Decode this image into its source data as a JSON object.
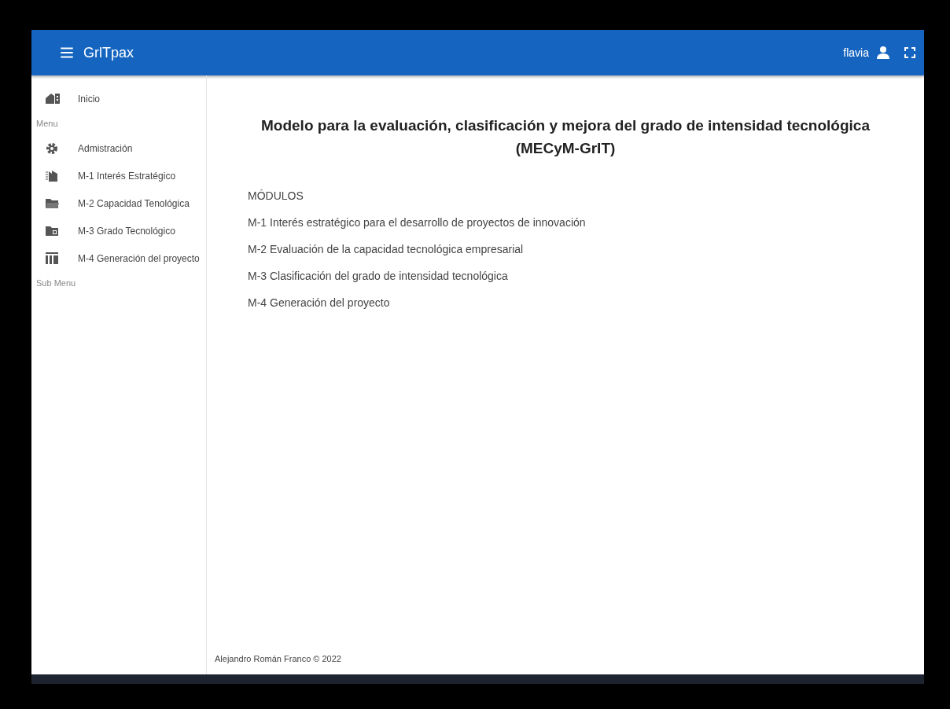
{
  "app_bar": {
    "title": "GrlTpax",
    "user": "flavia"
  },
  "sidebar": {
    "items": [
      {
        "kind": "link",
        "label": "Inicio"
      },
      {
        "kind": "header",
        "label": "Menu"
      },
      {
        "kind": "link",
        "label": "Admistración"
      },
      {
        "kind": "link",
        "label": "M-1 Interés Estratégico"
      },
      {
        "kind": "link",
        "label": "M-2 Capacidad Tenológica"
      },
      {
        "kind": "link",
        "label": "M-3 Grado Tecnológico"
      },
      {
        "kind": "link",
        "label": "M-4 Generación del proyecto"
      },
      {
        "kind": "header",
        "label": "Sub Menu"
      }
    ]
  },
  "main": {
    "title": "Modelo para la evaluación, clasificación y mejora del grado de intensidad tecnológica",
    "subtitle": "(MECyM-GrIT)",
    "modules_heading": "MÓDULOS",
    "modules": [
      "M-1 Interés estratégico para el desarrollo de proyectos de innovación",
      "M-2 Evaluación de la capacidad tecnológica empresarial",
      "M-3 Clasificación del grado de intensidad tecnológica",
      "M-4 Generación del proyecto"
    ]
  },
  "footer": "Alejandro Román Franco © 2022"
}
